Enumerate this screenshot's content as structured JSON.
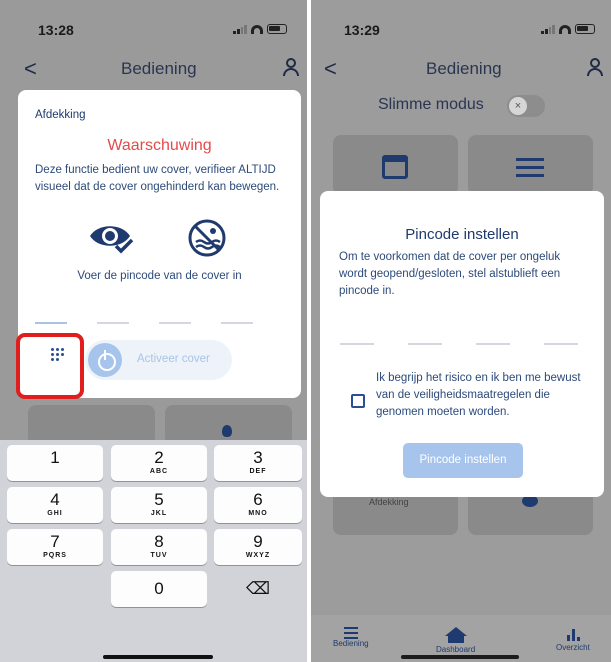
{
  "left": {
    "time": "13:28",
    "nav_title": "Bediening",
    "back_glyph": "<",
    "modal": {
      "section_label": "Afdekking",
      "warning_title": "Waarschuwing",
      "warning_text": "Deze functie bedient uw cover, verifieer ALTIJD visueel dat de cover ongehinderd kan bewegen.",
      "icons": [
        "eye-check-icon",
        "no-swimming-icon"
      ],
      "pin_prompt": "Voer de pincode van de cover in",
      "activate_label": "Activeer cover"
    },
    "keyboard": {
      "keys": [
        {
          "digit": "1",
          "letters": ""
        },
        {
          "digit": "2",
          "letters": "ABC"
        },
        {
          "digit": "3",
          "letters": "DEF"
        },
        {
          "digit": "4",
          "letters": "GHI"
        },
        {
          "digit": "5",
          "letters": "JKL"
        },
        {
          "digit": "6",
          "letters": "MNO"
        },
        {
          "digit": "7",
          "letters": "PQRS"
        },
        {
          "digit": "8",
          "letters": "TUV"
        },
        {
          "digit": "9",
          "letters": "WXYZ"
        },
        {
          "digit": "0",
          "letters": ""
        }
      ],
      "delete_glyph": "⌫"
    },
    "highlight_color": "#e01e1e"
  },
  "right": {
    "time": "13:29",
    "nav_title": "Bediening",
    "back_glyph": "<",
    "smart_mode_label": "Slimme modus",
    "toggle_glyph": "×",
    "modal": {
      "title": "Pincode instellen",
      "description": "Om te voorkomen dat de cover per ongeluk wordt geopend/gesloten, stel alstublieft een pincode in.",
      "risk_checkbox_label": "Ik begrijp het risico en ik ben me bewust van de veiligheidsmaatregelen die genomen moeten worden.",
      "risk_checkbox_checked": false,
      "submit_label": "Pincode instellen"
    },
    "behind_card_label": "Afdekking",
    "tabs": [
      {
        "label": "Bediening",
        "icon": "sliders-icon"
      },
      {
        "label": "Dashboard",
        "icon": "home-icon"
      },
      {
        "label": "Overzicht",
        "icon": "bar-chart-icon"
      }
    ]
  },
  "colors": {
    "accent": "#2a4e96",
    "warning": "#e34b4b",
    "disabled_button": "#a6c4ec"
  }
}
